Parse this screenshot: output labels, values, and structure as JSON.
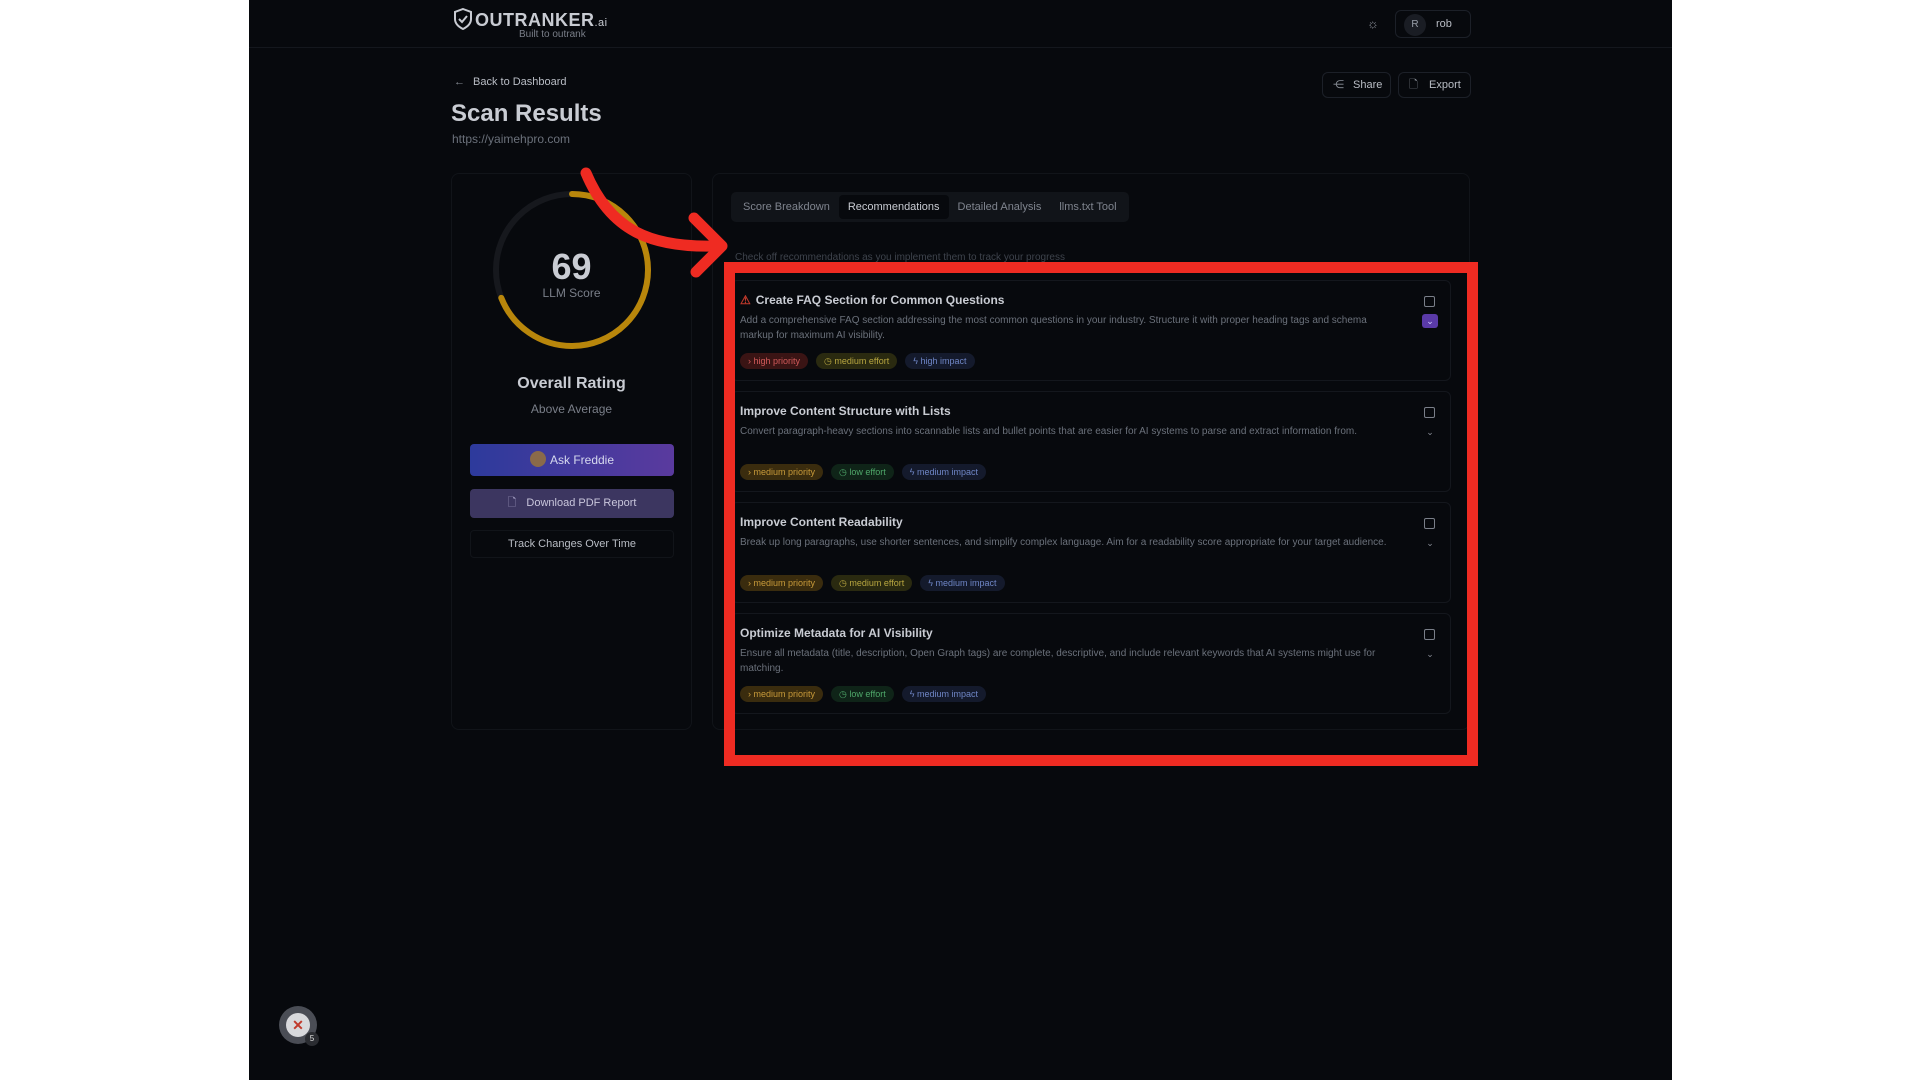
{
  "header": {
    "logo_text": "OUTRANKER",
    "logo_suffix": ".ai",
    "logo_tagline": "Built to outrank",
    "user_initial": "R",
    "user_name": "rob"
  },
  "page": {
    "back_label": "Back to Dashboard",
    "title": "Scan Results",
    "url": "https://yaimehpro.com",
    "share_label": "Share",
    "export_label": "Export"
  },
  "score_panel": {
    "score": "69",
    "score_label": "LLM Score",
    "score_fraction": 0.69,
    "rating_title": "Overall Rating",
    "rating_value": "Above Average",
    "ask_label": "Ask Freddie",
    "pdf_label": "Download PDF Report",
    "track_label": "Track Changes Over Time"
  },
  "tabs": [
    {
      "label": "Score Breakdown"
    },
    {
      "label": "Recommendations"
    },
    {
      "label": "Detailed Analysis"
    },
    {
      "label": "llms.txt Tool"
    }
  ],
  "note": "Check off recommendations as you implement them to track your progress",
  "recommendations": [
    {
      "title": "Create FAQ Section for Common Questions",
      "description": "Add a comprehensive FAQ section addressing the most common questions in your industry. Structure it with proper heading tags and schema markup for maximum AI visibility.",
      "priority": "high priority",
      "effort": "medium effort",
      "impact": "high impact"
    },
    {
      "title": "Improve Content Structure with Lists",
      "description": "Convert paragraph-heavy sections into scannable lists and bullet points that are easier for AI systems to parse and extract information from.",
      "priority": "medium priority",
      "effort": "low effort",
      "impact": "medium impact"
    },
    {
      "title": "Improve Content Readability",
      "description": "Break up long paragraphs, use shorter sentences, and simplify complex language. Aim for a readability score appropriate for your target audience.",
      "priority": "medium priority",
      "effort": "medium effort",
      "impact": "medium impact"
    },
    {
      "title": "Optimize Metadata for AI Visibility",
      "description": "Ensure all metadata (title, description, Open Graph tags) are complete, descriptive, and include relevant keywords that AI systems might use for matching.",
      "priority": "medium priority",
      "effort": "low effort",
      "impact": "medium impact"
    }
  ],
  "fab_badge": "5",
  "colors": {
    "annotation_red": "#ef2b22",
    "score_ring": "#b8860b",
    "accent_purple": "#5a3aa8"
  }
}
